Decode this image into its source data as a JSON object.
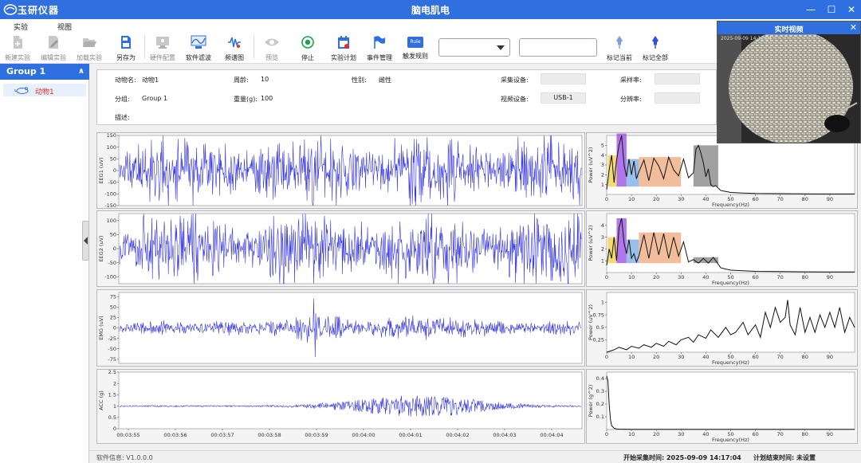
{
  "app": {
    "name": "玉研仪器",
    "window_title": "脑电肌电"
  },
  "window_controls": {
    "minimize": "—",
    "maximize": "☐",
    "close": "✕"
  },
  "menu": [
    {
      "label": "实验"
    },
    {
      "label": "视图"
    }
  ],
  "toolbar": {
    "buttons": [
      {
        "label": "新建实验",
        "icon": "new-file-icon",
        "enabled": false
      },
      {
        "label": "编辑实验",
        "icon": "edit-icon",
        "enabled": false
      },
      {
        "label": "加载实验",
        "icon": "folder-open-icon",
        "enabled": false
      },
      {
        "label": "另存为",
        "icon": "save-as-icon",
        "enabled": true
      },
      {
        "label": "硬件配置",
        "icon": "hardware-icon",
        "enabled": false
      },
      {
        "label": "软件滤波",
        "icon": "filter-icon",
        "enabled": true
      },
      {
        "label": "频谱图",
        "icon": "spectrum-icon",
        "enabled": true
      },
      {
        "label": "预览",
        "icon": "eye-icon",
        "enabled": false
      },
      {
        "label": "停止",
        "icon": "stop-icon",
        "enabled": true
      },
      {
        "label": "实验计划",
        "icon": "calendar-icon",
        "enabled": true
      },
      {
        "label": "事件管理",
        "icon": "flag-icon",
        "enabled": true
      },
      {
        "label": "触发规则",
        "icon": "rule-icon",
        "enabled": true
      },
      {
        "label": "标记当前",
        "icon": "pin-icon",
        "enabled": true
      },
      {
        "label": "标记全部",
        "icon": "pin-all-icon",
        "enabled": true
      }
    ],
    "rule_icon_text": "Rule",
    "combo_value": "",
    "text_input_value": ""
  },
  "sidebar": {
    "group": {
      "label": "Group 1",
      "chevron": "∧"
    },
    "animals": [
      {
        "label": "动物1"
      }
    ]
  },
  "info": {
    "animal_name": {
      "label": "动物名:",
      "value": "动物1"
    },
    "age": {
      "label": "周龄:",
      "value": "10"
    },
    "sex": {
      "label": "性别:",
      "value": "雌性"
    },
    "acq_device": {
      "label": "采集设备:",
      "value": ""
    },
    "sample_rate": {
      "label": "采样率:",
      "value": ""
    },
    "group": {
      "label": "分组:",
      "value": "Group 1"
    },
    "weight": {
      "label": "重量(g):",
      "value": "100"
    },
    "video_device": {
      "label": "视频设备:",
      "value": "USB-1"
    },
    "resolution": {
      "label": "分辨率:",
      "value": ""
    },
    "desc": {
      "label": "描述:",
      "value": ""
    }
  },
  "video": {
    "title": "实时视频",
    "close": "✕",
    "timestamp": "2025-09-09 14:17:04"
  },
  "status": {
    "software": "软件信息: V1.0.0.0",
    "start_time": "开始采集时间: 2025-09-09 14:17:04",
    "plan_end": "计划结束时间: 未设置"
  },
  "colors": {
    "accent": "#2f6fe0",
    "trace": "#3b3be0",
    "selected_text": "#e0302f"
  },
  "chart_data": [
    {
      "type": "line",
      "name": "EEG1",
      "ylabel": "EEG1 (uV)",
      "ylim": [
        -150,
        150
      ],
      "yticks": [
        -150,
        -100,
        -50,
        0,
        50,
        100,
        150
      ],
      "series_style": "noise",
      "amplitude": 70
    },
    {
      "type": "line",
      "name": "EEG2",
      "ylabel": "EEG2 (uV)",
      "ylim": [
        -125,
        125
      ],
      "yticks": [
        -100,
        -50,
        0,
        50,
        100
      ],
      "series_style": "noise",
      "amplitude": 60
    },
    {
      "type": "line",
      "name": "EMG",
      "ylabel": "EMG (uV)",
      "ylim": [
        -85,
        85
      ],
      "yticks": [
        -75,
        -50,
        -25,
        0,
        25,
        50,
        75
      ],
      "series_style": "burst",
      "amplitude": 20
    },
    {
      "type": "line",
      "name": "ACC",
      "ylabel": "ACC (g)",
      "ylim": [
        0,
        2.5
      ],
      "yticks": [
        0,
        0.5,
        1,
        1.5,
        2,
        2.5
      ],
      "series_style": "acc",
      "baseline": 1.0,
      "x_tick_labels": [
        "00:03:55",
        "00:03:56",
        "00:03:57",
        "00:03:58",
        "00:03:59",
        "00:04:00",
        "00:04:01",
        "00:04:02",
        "00:04:03",
        "00:04:04"
      ]
    },
    {
      "type": "line",
      "name": "EEG1-PSD",
      "xlabel": "Frequency(Hz)",
      "ylabel": "Power (uV^2)",
      "xlim": [
        0,
        100
      ],
      "xticks": [
        0,
        10,
        20,
        30,
        40,
        50,
        60,
        70,
        80,
        90
      ],
      "ylim": [
        0,
        6
      ],
      "yticks": [
        1,
        2,
        3,
        4,
        5
      ],
      "bands": [
        {
          "range": [
            0.5,
            4
          ],
          "color": "#f3d35a"
        },
        {
          "range": [
            4,
            8
          ],
          "color": "#a45ee8"
        },
        {
          "range": [
            8,
            13
          ],
          "color": "#8ab4e8"
        },
        {
          "range": [
            13,
            30
          ],
          "color": "#f0b28a"
        },
        {
          "range": [
            35,
            45
          ],
          "color": "#909090"
        }
      ],
      "x": [
        0,
        1,
        2,
        3,
        4,
        5,
        6,
        7,
        8,
        9,
        10,
        11,
        12,
        13,
        15,
        17,
        19,
        21,
        23,
        25,
        27,
        29,
        31,
        33,
        35,
        36,
        37,
        38,
        39,
        40,
        41,
        42,
        43,
        44,
        46,
        48,
        50,
        55,
        60,
        70,
        80,
        90,
        100
      ],
      "y": [
        0.5,
        2.5,
        4.0,
        1.2,
        3.5,
        5.0,
        6.2,
        3.0,
        1.8,
        3.6,
        2.0,
        3.4,
        1.6,
        2.3,
        3.5,
        1.4,
        3.7,
        2.9,
        1.6,
        3.8,
        2.5,
        1.9,
        3.6,
        1.7,
        2.2,
        4.6,
        5.0,
        4.2,
        3.2,
        1.8,
        2.6,
        1.0,
        0.8,
        0.9,
        0.4,
        0.3,
        0.2,
        0.15,
        0.1,
        0.08,
        0.06,
        0.05,
        0.05
      ]
    },
    {
      "type": "line",
      "name": "EEG2-PSD",
      "xlabel": "Frequency(Hz)",
      "ylabel": "Power (uV^2)",
      "xlim": [
        0,
        100
      ],
      "xticks": [
        0,
        10,
        20,
        30,
        40,
        50,
        60,
        70,
        80,
        90
      ],
      "ylim": [
        0,
        5
      ],
      "yticks": [
        1,
        2,
        3,
        4
      ],
      "bands": [
        {
          "range": [
            0.5,
            4
          ],
          "color": "#f3d35a"
        },
        {
          "range": [
            4,
            8
          ],
          "color": "#a45ee8"
        },
        {
          "range": [
            8,
            13
          ],
          "color": "#8ab4e8"
        },
        {
          "range": [
            13,
            30
          ],
          "color": "#f0b28a"
        },
        {
          "range": [
            35,
            45
          ],
          "color": "#909090"
        }
      ],
      "x": [
        0,
        1,
        2,
        3,
        4,
        5,
        6,
        7,
        8,
        9,
        10,
        11,
        12,
        13,
        15,
        17,
        19,
        21,
        23,
        25,
        27,
        29,
        31,
        33,
        35,
        37,
        39,
        41,
        43,
        44,
        46,
        48,
        50,
        55,
        60,
        70,
        80,
        90,
        100
      ],
      "y": [
        0.6,
        2.0,
        1.2,
        3.0,
        1.0,
        3.8,
        4.6,
        2.5,
        1.6,
        2.8,
        1.2,
        1.6,
        0.9,
        1.4,
        3.2,
        1.2,
        3.4,
        1.5,
        3.3,
        1.2,
        3.0,
        1.4,
        2.6,
        0.9,
        1.1,
        0.8,
        1.2,
        0.8,
        1.3,
        1.0,
        0.4,
        0.3,
        0.2,
        0.15,
        0.1,
        0.08,
        0.06,
        0.05,
        0.05
      ]
    },
    {
      "type": "line",
      "name": "EMG-PSD",
      "xlabel": "Frequency(Hz)",
      "ylabel": "Power (uV^2)",
      "xlim": [
        0,
        100
      ],
      "xticks": [
        0,
        10,
        20,
        30,
        40,
        50,
        60,
        70,
        80,
        90
      ],
      "ylim": [
        0,
        1.2
      ],
      "yticks": [
        0.25,
        0.5,
        0.75,
        1
      ],
      "x": [
        0,
        3,
        5,
        8,
        10,
        13,
        15,
        18,
        20,
        23,
        25,
        28,
        30,
        33,
        35,
        37,
        40,
        42,
        45,
        48,
        50,
        52,
        55,
        57,
        60,
        62,
        64,
        66,
        68,
        70,
        72,
        73,
        74,
        76,
        78,
        80,
        82,
        84,
        86,
        88,
        90,
        92,
        94,
        96,
        98,
        100
      ],
      "y": [
        0.0,
        0.05,
        0.1,
        0.05,
        0.12,
        0.08,
        0.15,
        0.1,
        0.18,
        0.12,
        0.22,
        0.15,
        0.25,
        0.3,
        0.2,
        0.35,
        0.28,
        0.45,
        0.3,
        0.5,
        0.35,
        0.4,
        0.6,
        0.35,
        0.55,
        0.3,
        0.8,
        0.5,
        0.9,
        0.6,
        0.7,
        1.05,
        0.55,
        0.35,
        0.9,
        0.4,
        0.7,
        0.4,
        0.75,
        0.5,
        0.8,
        0.5,
        0.9,
        0.4,
        0.7,
        0.5
      ]
    },
    {
      "type": "line",
      "name": "ACC-PSD",
      "xlabel": "Frequency(Hz)",
      "ylabel": "Power (g^2)",
      "xlim": [
        0,
        100
      ],
      "xticks": [
        0,
        10,
        20,
        30,
        40,
        50,
        60,
        70,
        80,
        90
      ],
      "ylim": [
        0,
        0.45
      ],
      "yticks": [
        0.1,
        0.2,
        0.3,
        0.4
      ],
      "x": [
        0,
        0.5,
        1,
        1.5,
        2,
        3,
        4,
        5,
        10,
        20,
        40,
        60,
        80,
        100
      ],
      "y": [
        0.42,
        0.38,
        0.2,
        0.08,
        0.03,
        0.01,
        0.005,
        0.003,
        0.002,
        0.001,
        0.001,
        0.001,
        0.001,
        0.001
      ]
    }
  ]
}
